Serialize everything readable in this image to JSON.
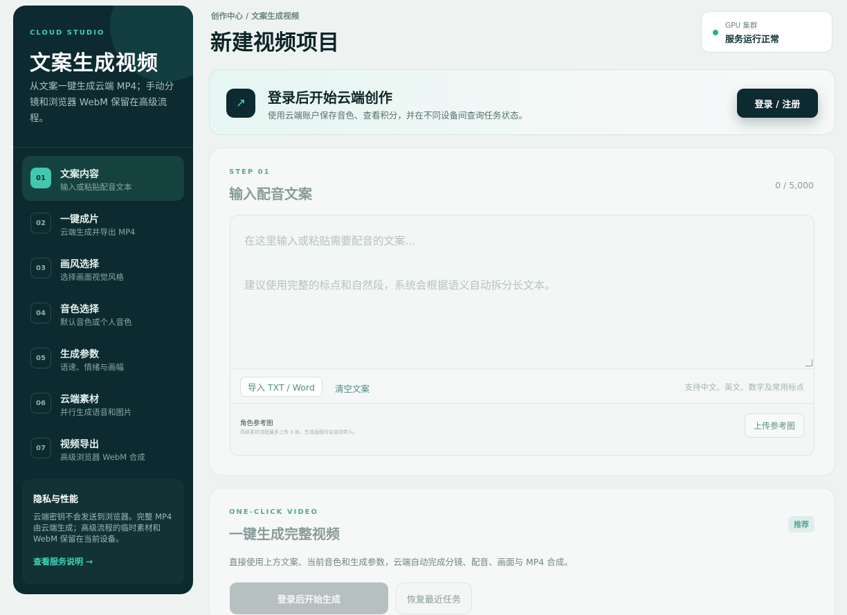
{
  "sidebar": {
    "brand_tag": "CLOUD STUDIO",
    "brand_title": "文案生成视频",
    "brand_desc": "从文案一键生成云端 MP4；手动分镜和浏览器 WebM 保留在高级流程。",
    "items": [
      {
        "num": "01",
        "title": "文案内容",
        "sub": "输入或粘贴配音文本",
        "active": true
      },
      {
        "num": "02",
        "title": "一键成片",
        "sub": "云端生成并导出 MP4",
        "active": false
      },
      {
        "num": "03",
        "title": "画风选择",
        "sub": "选择画面视觉风格",
        "active": false
      },
      {
        "num": "04",
        "title": "音色选择",
        "sub": "默认音色或个人音色",
        "active": false
      },
      {
        "num": "05",
        "title": "生成参数",
        "sub": "语速、情绪与画幅",
        "active": false
      },
      {
        "num": "06",
        "title": "云端素材",
        "sub": "并行生成语音和图片",
        "active": false
      },
      {
        "num": "07",
        "title": "视频导出",
        "sub": "高级浏览器 WebM 合成",
        "active": false
      }
    ],
    "privacy": {
      "title": "隐私与性能",
      "body": "云端密钥不会发送到浏览器。完整 MP4 由云端生成；高级流程的临时素材和 WebM 保留在当前设备。",
      "link": "查看服务说明 →"
    }
  },
  "header": {
    "breadcrumb": "创作中心 / 文案生成视频",
    "title": "新建视频项目",
    "status_label": "GPU 集群",
    "status_value": "服务运行正常"
  },
  "login": {
    "icon": "arrow-up-right-icon",
    "title": "登录后开始云端创作",
    "sub": "使用云端账户保存音色、查看积分，并在不同设备间查询任务状态。",
    "button": "登录 / 注册"
  },
  "step1": {
    "tag": "STEP 01",
    "title": "输入配音文案",
    "counter": "0 / 5,000",
    "placeholder_1": "在这里输入或粘贴需要配音的文案...",
    "placeholder_2": "建议使用完整的标点和自然段，系统会根据语义自动拆分长文本。",
    "import_label": "导入 TXT / Word",
    "clear_label": "清空文案",
    "hint": "支持中文、英文、数字及常用标点",
    "ref_title": "角色参考图",
    "ref_sub": "高级素材流程最多上传 3 张，生成画面时会自动带入。",
    "upload_label": "上传参考图"
  },
  "step2": {
    "tag": "ONE-CLICK VIDEO",
    "title": "一键生成完整视频",
    "badge": "推荐",
    "desc": "直接使用上方文案、当前音色和生成参数，云端自动完成分镜、配音、画面与 MP4 合成。",
    "generate_label": "登录后开始生成",
    "restore_label": "恢复最近任务"
  },
  "colors": {
    "accent": "#3fd1b5",
    "sidebar_bg": "#0c2a2f",
    "status_ok": "#22b38a"
  }
}
